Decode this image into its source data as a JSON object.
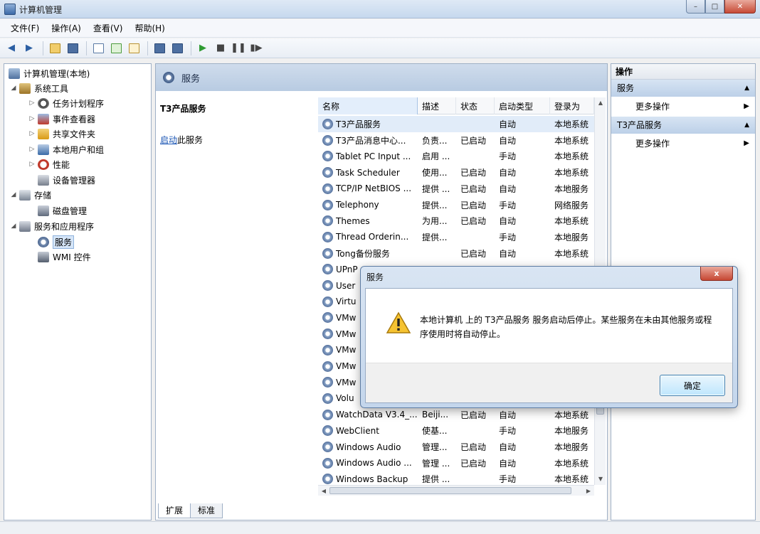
{
  "window": {
    "title": "计算机管理",
    "minimize": "–",
    "maximize": "□",
    "close": "✕"
  },
  "menu": [
    "文件(F)",
    "操作(A)",
    "查看(V)",
    "帮助(H)"
  ],
  "tree": {
    "root": "计算机管理(本地)",
    "system_tools": "系统工具",
    "task_scheduler": "任务计划程序",
    "event_viewer": "事件查看器",
    "shared_folders": "共享文件夹",
    "local_users": "本地用户和组",
    "performance": "性能",
    "device_manager": "设备管理器",
    "storage": "存储",
    "disk_management": "磁盘管理",
    "services_apps": "服务和应用程序",
    "services": "服务",
    "wmi": "WMI 控件"
  },
  "center": {
    "header": "服务",
    "selected_service": "T3产品服务",
    "action_link": "启动",
    "action_suffix": "此服务"
  },
  "columns": [
    "名称",
    "描述",
    "状态",
    "启动类型",
    "登录为"
  ],
  "services": [
    [
      "T3产品服务",
      "",
      "",
      "自动",
      "本地系统"
    ],
    [
      "T3产品消息中心...",
      "负责...",
      "已启动",
      "自动",
      "本地系统"
    ],
    [
      "Tablet PC Input ...",
      "启用 ...",
      "",
      "手动",
      "本地系统"
    ],
    [
      "Task Scheduler",
      "使用...",
      "已启动",
      "自动",
      "本地系统"
    ],
    [
      "TCP/IP NetBIOS ...",
      "提供 ...",
      "已启动",
      "自动",
      "本地服务"
    ],
    [
      "Telephony",
      "提供...",
      "已启动",
      "手动",
      "网络服务"
    ],
    [
      "Themes",
      "为用...",
      "已启动",
      "自动",
      "本地系统"
    ],
    [
      "Thread Orderin...",
      "提供...",
      "",
      "手动",
      "本地服务"
    ],
    [
      "Tong备份服务",
      "",
      "已启动",
      "自动",
      "本地系统"
    ],
    [
      "UPnP",
      "",
      "",
      "",
      ""
    ],
    [
      "User",
      "",
      "",
      "",
      ""
    ],
    [
      "Virtu",
      "",
      "",
      "",
      ""
    ],
    [
      "VMw",
      "",
      "",
      "",
      ""
    ],
    [
      "VMw",
      "",
      "",
      "",
      ""
    ],
    [
      "VMw",
      "",
      "",
      "",
      ""
    ],
    [
      "VMw",
      "",
      "",
      "",
      ""
    ],
    [
      "VMw",
      "",
      "",
      "",
      ""
    ],
    [
      "Volu",
      "",
      "",
      "",
      ""
    ],
    [
      "WatchData V3.4_...",
      "Beiji...",
      "已启动",
      "自动",
      "本地系统"
    ],
    [
      "WebClient",
      "使基...",
      "",
      "手动",
      "本地服务"
    ],
    [
      "Windows Audio",
      "管理...",
      "已启动",
      "自动",
      "本地服务"
    ],
    [
      "Windows Audio ...",
      "管理 ...",
      "已启动",
      "自动",
      "本地系统"
    ],
    [
      "Windows Backup",
      "提供 ...",
      "",
      "手动",
      "本地系统"
    ]
  ],
  "tabs": [
    "扩展",
    "标准"
  ],
  "actions": {
    "header": "操作",
    "group1": "服务",
    "group2": "T3产品服务",
    "more": "更多操作"
  },
  "dialog": {
    "title": "服务",
    "message": "本地计算机 上的 T3产品服务 服务启动后停止。某些服务在未由其他服务或程序使用时将自动停止。",
    "ok": "确定",
    "close": "x"
  }
}
